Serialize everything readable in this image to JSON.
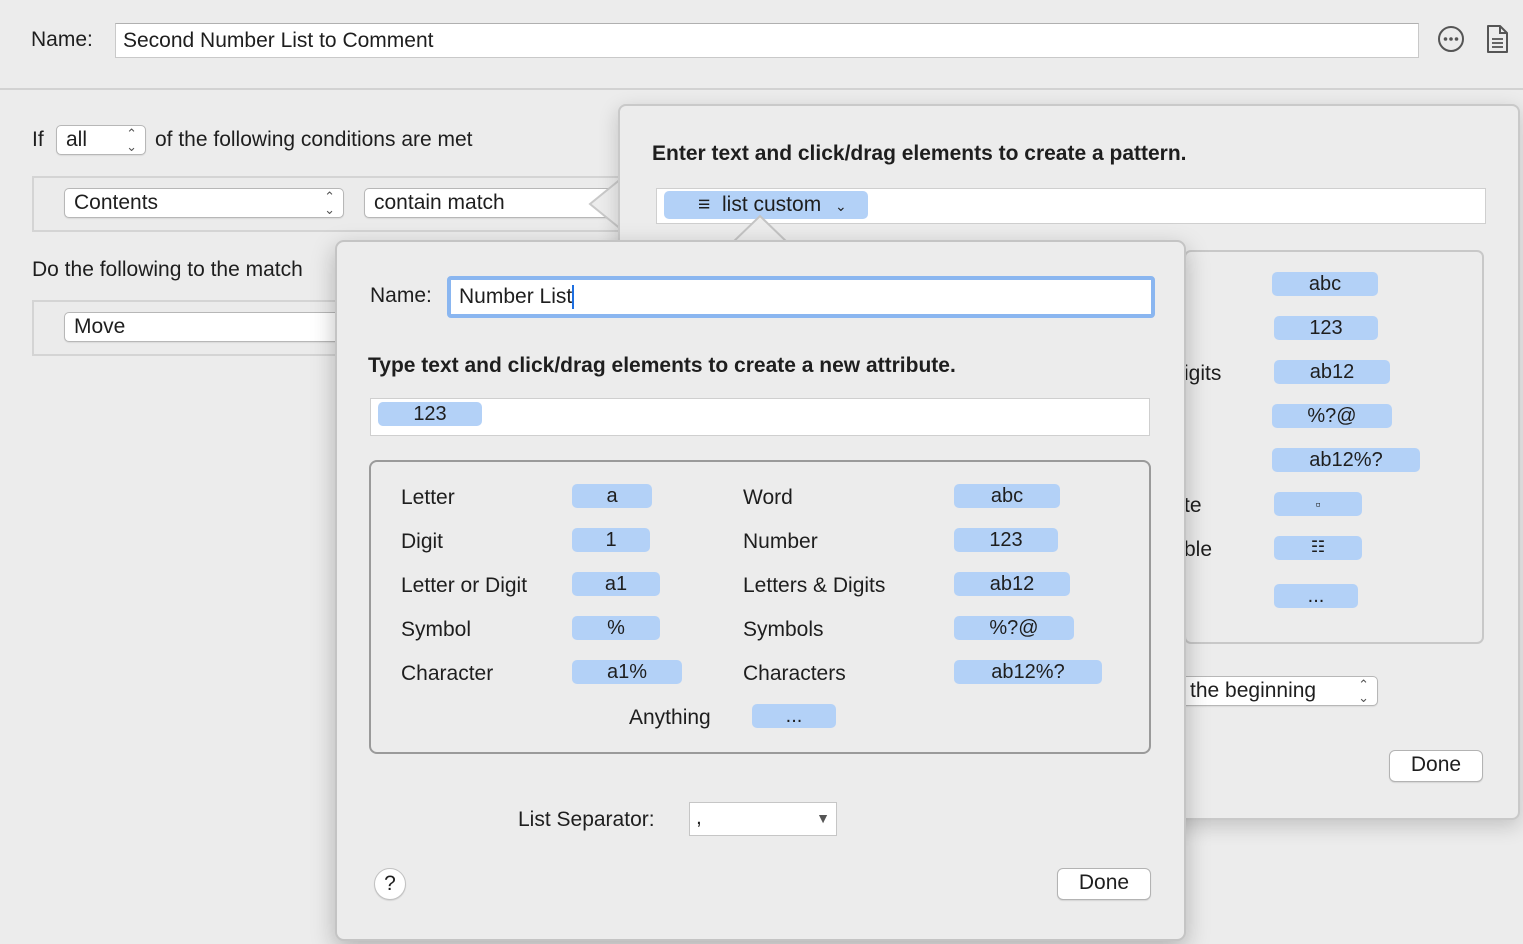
{
  "header": {
    "name_label": "Name:",
    "name_value": "Second Number List to Comment",
    "more_icon": "ellipsis-circle-icon",
    "doc_icon": "document-icon"
  },
  "conditions": {
    "if_label": "If",
    "match_mode": "all",
    "conditions_text": "of the following conditions are met",
    "attribute": "Contents",
    "operator": "contain match"
  },
  "actions": {
    "do_text": "Do the following to the match",
    "action": "Move",
    "position": "the beginning",
    "done_label": "Done"
  },
  "pattern_panel": {
    "instruction": "Enter text and click/drag elements to create a pattern.",
    "token_label": "list custom",
    "token_icon": "list-icon",
    "elements_partial": [
      {
        "label": "",
        "pill": "abc"
      },
      {
        "label": "",
        "pill": "123"
      },
      {
        "label": "igits",
        "pill": "ab12"
      },
      {
        "label": "",
        "pill": "%?@"
      },
      {
        "label": "",
        "pill": "ab12%?"
      },
      {
        "label": "te",
        "pill": "▫"
      },
      {
        "label": "ble",
        "pill": "☷"
      },
      {
        "label": "",
        "pill": "..."
      }
    ]
  },
  "attr_popover": {
    "name_label": "Name:",
    "name_value": "Number List",
    "instruction": "Type text and click/drag elements to create a new attribute.",
    "token": "123",
    "elements_left": [
      {
        "label": "Letter",
        "pill": "a"
      },
      {
        "label": "Digit",
        "pill": "1"
      },
      {
        "label": "Letter or Digit",
        "pill": "a1"
      },
      {
        "label": "Symbol",
        "pill": "%"
      },
      {
        "label": "Character",
        "pill": "a1%"
      }
    ],
    "elements_right": [
      {
        "label": "Word",
        "pill": "abc"
      },
      {
        "label": "Number",
        "pill": "123"
      },
      {
        "label": "Letters & Digits",
        "pill": "ab12"
      },
      {
        "label": "Symbols",
        "pill": "%?@"
      },
      {
        "label": "Characters",
        "pill": "ab12%?"
      }
    ],
    "anything": {
      "label": "Anything",
      "pill": "..."
    },
    "separator_label": "List Separator:",
    "separator_value": ",",
    "help_label": "?",
    "done_label": "Done"
  }
}
